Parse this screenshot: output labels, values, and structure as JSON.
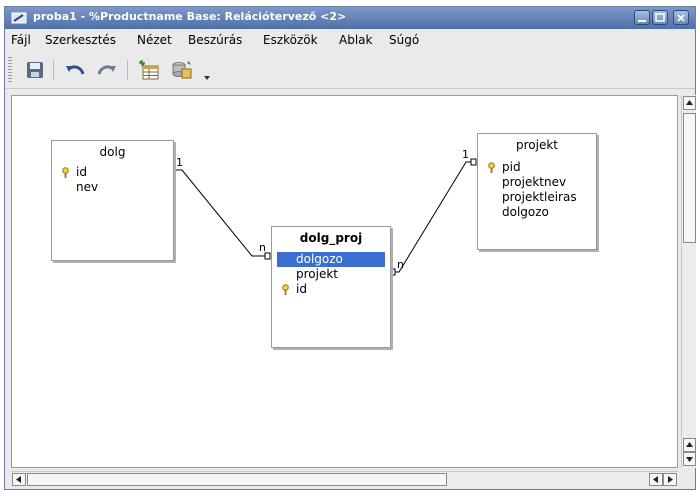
{
  "window": {
    "title": "proba1 - %Productname Base: Relációtervező <2>"
  },
  "menu": [
    {
      "label": "Fájl"
    },
    {
      "label": "Szerkesztés"
    },
    {
      "label": "Nézet"
    },
    {
      "label": "Beszúrás"
    },
    {
      "label": "Eszközök"
    },
    {
      "label": "Ablak"
    },
    {
      "label": "Súgó"
    }
  ],
  "toolbar": {
    "buttons": [
      {
        "name": "save-icon"
      },
      {
        "name": "undo-icon"
      },
      {
        "name": "redo-icon"
      },
      {
        "name": "add-table-icon"
      },
      {
        "name": "new-relation-icon"
      }
    ]
  },
  "tables": {
    "dolg": {
      "title": "dolg",
      "fields": [
        {
          "name": "id",
          "key": true
        },
        {
          "name": "nev",
          "key": false
        }
      ]
    },
    "dolg_proj": {
      "title": "dolg_proj",
      "fields": [
        {
          "name": "dolgozo",
          "key": false,
          "selected": true
        },
        {
          "name": "projekt",
          "key": false
        },
        {
          "name": "id",
          "key": true
        }
      ]
    },
    "projekt": {
      "title": "projekt",
      "fields": [
        {
          "name": "pid",
          "key": true
        },
        {
          "name": "projektnev",
          "key": false
        },
        {
          "name": "projektleiras",
          "key": false
        },
        {
          "name": "dolgozo",
          "key": false
        }
      ]
    }
  },
  "relations": [
    {
      "from_label": "1",
      "to_label": "n"
    },
    {
      "from_label": "1",
      "to_label": "n"
    }
  ],
  "colors": {
    "selection": "#3a6fd1",
    "titlebar": "#5f7fb6"
  }
}
